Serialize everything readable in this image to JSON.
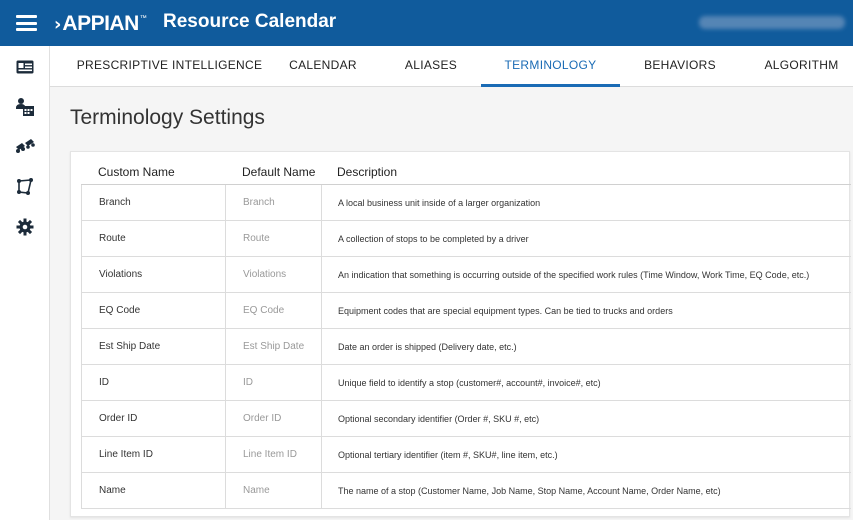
{
  "header": {
    "logo": "APPIAN",
    "app_title": "Resource Calendar",
    "user_name_blurred": true,
    "bg_color": "#105b9c"
  },
  "sidebar": {
    "items": [
      {
        "icon": "id-card-icon"
      },
      {
        "icon": "calendar-user-icon"
      },
      {
        "icon": "trucks-icon"
      },
      {
        "icon": "route-icon"
      },
      {
        "icon": "gear-icon"
      }
    ]
  },
  "tabs": [
    {
      "label": "PRESCRIPTIVE INTELLIGENCE",
      "active": false
    },
    {
      "label": "CALENDAR",
      "active": false
    },
    {
      "label": "ALIASES",
      "active": false
    },
    {
      "label": "TERMINOLOGY",
      "active": true
    },
    {
      "label": "BEHAVIORS",
      "active": false
    },
    {
      "label": "ALGORITHM",
      "active": false
    }
  ],
  "page": {
    "title": "Terminology Settings"
  },
  "table": {
    "headers": [
      "Custom Name",
      "Default Name",
      "Description"
    ],
    "rows": [
      {
        "custom": "Branch",
        "default": "Branch",
        "description": "A local business unit inside of a larger organization"
      },
      {
        "custom": "Route",
        "default": "Route",
        "description": "A collection of stops to be completed by a driver"
      },
      {
        "custom": "Violations",
        "default": "Violations",
        "description": "An indication that something is occurring outside of the specified work rules (Time Window, Work Time, EQ Code, etc.)"
      },
      {
        "custom": "EQ Code",
        "default": "EQ Code",
        "description": "Equipment codes that are special equipment types. Can be tied to trucks and orders"
      },
      {
        "custom": "Est Ship Date",
        "default": "Est Ship Date",
        "description": "Date an order is shipped (Delivery date, etc.)"
      },
      {
        "custom": "ID",
        "default": "ID",
        "description": "Unique field to identify a stop (customer#, account#, invoice#, etc)"
      },
      {
        "custom": "Order ID",
        "default": "Order ID",
        "description": "Optional secondary identifier (Order #, SKU #, etc)"
      },
      {
        "custom": "Line Item ID",
        "default": "Line Item ID",
        "description": "Optional tertiary identifier (item #, SKU#, line item, etc.)"
      },
      {
        "custom": "Name",
        "default": "Name",
        "description": "The name of a stop (Customer Name, Job Name, Stop Name, Account Name, Order Name, etc)"
      }
    ]
  }
}
